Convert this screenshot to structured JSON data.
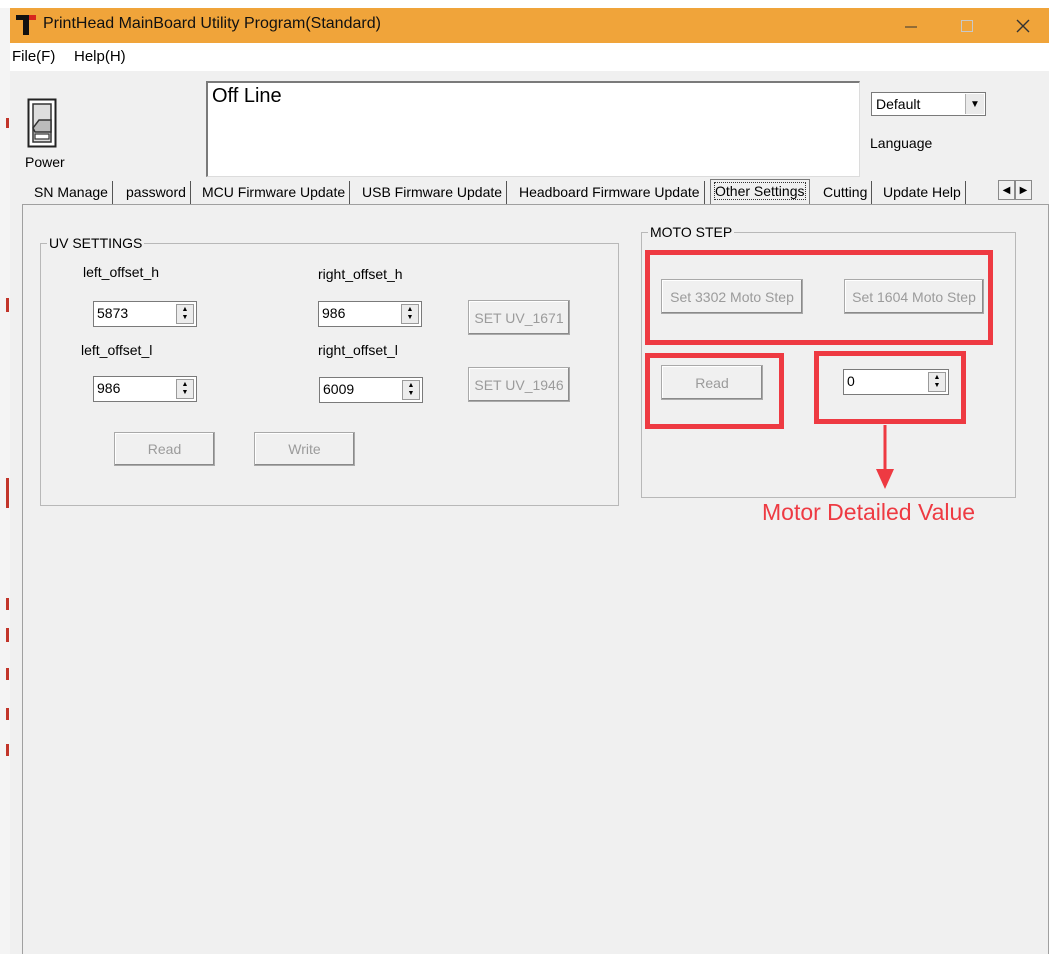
{
  "window": {
    "title": "PrintHead MainBoard Utility Program(Standard)",
    "titlebar_color": "#f0a43a"
  },
  "menu": {
    "items": [
      "File(F)",
      "Help(H)"
    ]
  },
  "power": {
    "label": "Power"
  },
  "status": {
    "text": "Off Line"
  },
  "language": {
    "selected": "Default",
    "label": "Language"
  },
  "tabs": [
    "SN Manage",
    "password",
    "MCU Firmware Update",
    "USB Firmware Update",
    "Headboard Firmware Update",
    "Other Settings",
    "Cutting",
    "Update Help"
  ],
  "active_tab": "Other Settings",
  "uv_settings": {
    "title": "UV SETTINGS",
    "left_offset_h": {
      "label": "left_offset_h",
      "value": "5873"
    },
    "right_offset_h": {
      "label": "right_offset_h",
      "value": "986"
    },
    "left_offset_l": {
      "label": "left_offset_l",
      "value": "986"
    },
    "right_offset_l": {
      "label": "right_offset_l",
      "value": "6009"
    },
    "set_uv_1671": "SET UV_1671",
    "set_uv_1946": "SET UV_1946",
    "read": "Read",
    "write": "Write"
  },
  "moto_step": {
    "title": "MOTO STEP",
    "set_3302": "Set 3302 Moto Step",
    "set_1604": "Set 1604 Moto Step",
    "read": "Read",
    "value": "0"
  },
  "annotation": {
    "text": "Motor Detailed Value",
    "color": "#ee3a42"
  }
}
